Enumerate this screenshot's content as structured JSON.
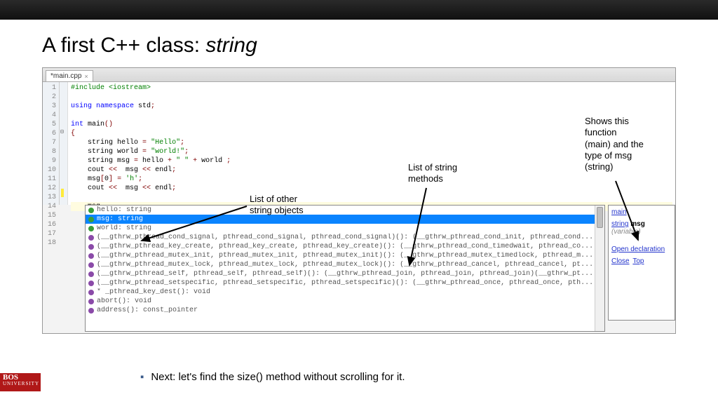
{
  "title_prefix": "A first C++ class: ",
  "title_italic": "string",
  "tab_name": "*main.cpp",
  "code_lines": [
    {
      "n": "1",
      "html": "<span class='pp'>#include &lt;iostream&gt;</span>"
    },
    {
      "n": "2",
      "html": ""
    },
    {
      "n": "3",
      "html": "<span class='kw'>using namespace</span> std<span class='op'>;</span>"
    },
    {
      "n": "4",
      "html": ""
    },
    {
      "n": "5",
      "html": "<span class='kw'>int</span> main<span class='op'>()</span>"
    },
    {
      "n": "6",
      "html": "<span class='op'>{</span>"
    },
    {
      "n": "7",
      "html": "    string hello <span class='op'>=</span> <span class='str'>\"Hello\"</span><span class='op'>;</span>"
    },
    {
      "n": "8",
      "html": "    string world <span class='op'>=</span> <span class='str'>\"world!\"</span><span class='op'>;</span>"
    },
    {
      "n": "9",
      "html": "    string msg <span class='op'>=</span> hello <span class='op'>+</span> <span class='str'>\" \"</span> <span class='op'>+</span> world <span class='op'>;</span>"
    },
    {
      "n": "10",
      "html": "    cout <span class='op'>&lt;&lt;</span>  msg <span class='op'>&lt;&lt;</span> endl<span class='op'>;</span>"
    },
    {
      "n": "11",
      "html": "    msg<span class='op'>[</span><span class='num'>0</span><span class='op'>]</span> <span class='op'>=</span> <span class='str'>'h'</span><span class='op'>;</span>"
    },
    {
      "n": "12",
      "html": "    cout <span class='op'>&lt;&lt;</span>  msg <span class='op'>&lt;&lt;</span> endl<span class='op'>;</span>"
    },
    {
      "n": "13",
      "html": ""
    },
    {
      "n": "14",
      "html": "    msg"
    },
    {
      "n": "15",
      "html": ""
    },
    {
      "n": "16",
      "html": ""
    },
    {
      "n": "17",
      "html": ""
    },
    {
      "n": "18",
      "html": ""
    }
  ],
  "popup_items": [
    {
      "cls": "",
      "icon": "bullet",
      "text": "hello: string"
    },
    {
      "cls": "sel",
      "icon": "bullet",
      "text": "msg: string"
    },
    {
      "cls": "",
      "icon": "bullet",
      "text": "world: string"
    },
    {
      "cls": "",
      "icon": "bullet purple",
      "text": "(__gthrw_pthread_cond_signal, pthread_cond_signal, pthread_cond_signal)(): (__gthrw_pthread_cond_init, pthread_cond..."
    },
    {
      "cls": "",
      "icon": "bullet purple",
      "text": "(__gthrw_pthread_key_create, pthread_key_create, pthread_key_create)(): (__gthrw_pthread_cond_timedwait, pthread_co..."
    },
    {
      "cls": "",
      "icon": "bullet purple",
      "text": "(__gthrw_pthread_mutex_init, pthread_mutex_init, pthread_mutex_init)(): (__gthrw_pthread_mutex_timedlock, pthread_m..."
    },
    {
      "cls": "",
      "icon": "bullet purple",
      "text": "(__gthrw_pthread_mutex_lock, pthread_mutex_lock, pthread_mutex_lock)(): (__gthrw_pthread_cancel, pthread_cancel, pt..."
    },
    {
      "cls": "",
      "icon": "bullet purple",
      "text": "(__gthrw_pthread_self, pthread_self, pthread_self)(): (__gthrw_pthread_join, pthread_join, pthread_join)(__gthrw_pt..."
    },
    {
      "cls": "",
      "icon": "bullet purple",
      "text": "(__gthrw_pthread_setspecific, pthread_setspecific, pthread_setspecific)(): (__gthrw_pthread_once, pthread_once, pth..."
    },
    {
      "cls": "",
      "icon": "bullet purple",
      "text": "* _pthread_key_dest(): void"
    },
    {
      "cls": "",
      "icon": "bullet purple",
      "text": "abort(): void"
    },
    {
      "cls": "",
      "icon": "bullet purple",
      "text": "address(): const_pointer"
    }
  ],
  "side": {
    "main": "main",
    "type": "string",
    "var": "msg",
    "varlbl": "(variable)",
    "open": "Open declaration",
    "close": "Close",
    "top": "Top"
  },
  "callouts": {
    "c1": "List of other\nstring objects",
    "c2": "List of string\nmethods",
    "c3": "Shows this\nfunction\n(main) and the\ntype of msg\n(string)"
  },
  "footer": "Next: let's find the size() method without scrolling for it.",
  "logo1": "BOS",
  "logo2": "UNIVERSITY"
}
